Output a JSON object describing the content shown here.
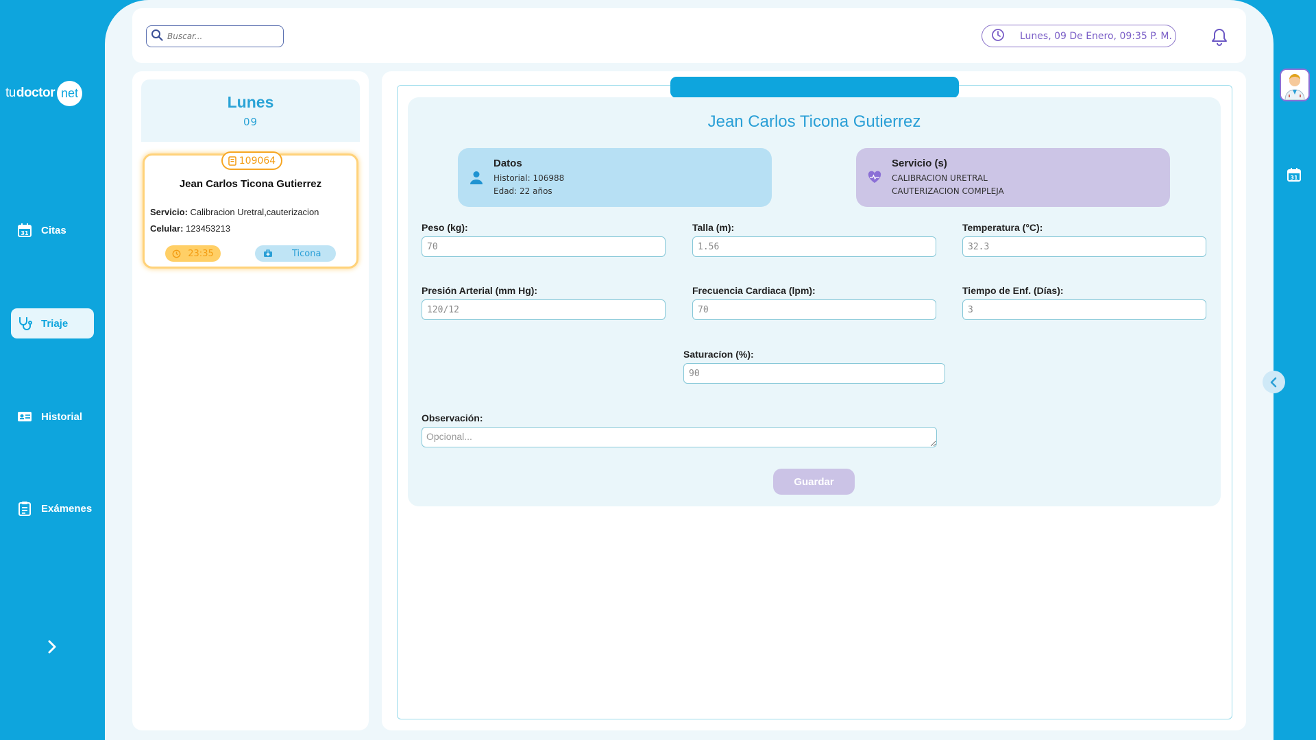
{
  "logo": {
    "part1": "tu",
    "part2": "doctor",
    "part3": "net"
  },
  "nav": {
    "citas": "Citas",
    "triaje": "Triaje",
    "historial": "Historial",
    "examenes": "Exámenes",
    "active": "Triaje"
  },
  "topbar": {
    "search_placeholder": "Buscar...",
    "datetime": "Lunes, 09 De Enero, 09:35 P. M."
  },
  "appointments": {
    "day_name": "Lunes",
    "day_number": "09",
    "items": [
      {
        "code": "109064",
        "name": "Jean Carlos Ticona Gutierrez",
        "servicio_label": "Servicio:",
        "servicio": "Calibracion Uretral,cauterizacion",
        "celular_label": "Celular:",
        "celular": "123453213",
        "time": "23:35",
        "doctor": "Ticona"
      }
    ]
  },
  "patient": {
    "name": "Jean Carlos Ticona Gutierrez",
    "datos_title": "Datos",
    "historial": "Historial: 106988",
    "edad": "Edad: 22 años",
    "servicios_title": "Servicio (s)",
    "servicios": [
      "CALIBRACION URETRAL",
      "CAUTERIZACION COMPLEJA"
    ]
  },
  "form": {
    "peso_label": "Peso (kg):",
    "peso": "70",
    "talla_label": "Talla (m):",
    "talla": "1.56",
    "temp_label": "Temperatura (°C):",
    "temp": "32.3",
    "presion_label": "Presión Arterial (mm Hg):",
    "presion": "120/12",
    "frecuencia_label": "Frecuencia Cardiaca (lpm):",
    "frecuencia": "70",
    "tiempo_label": "Tiempo de Enf. (Días):",
    "tiempo": "3",
    "saturacion_label": "Saturacíon (%):",
    "saturacion": "90",
    "observacion_label": "Observación:",
    "observacion_placeholder": "Opcional...",
    "save_label": "Guardar"
  },
  "colors": {
    "primary": "#0ea5dd",
    "accent_purple": "#8a73c9",
    "appointment_highlight": "#ffd27a"
  }
}
